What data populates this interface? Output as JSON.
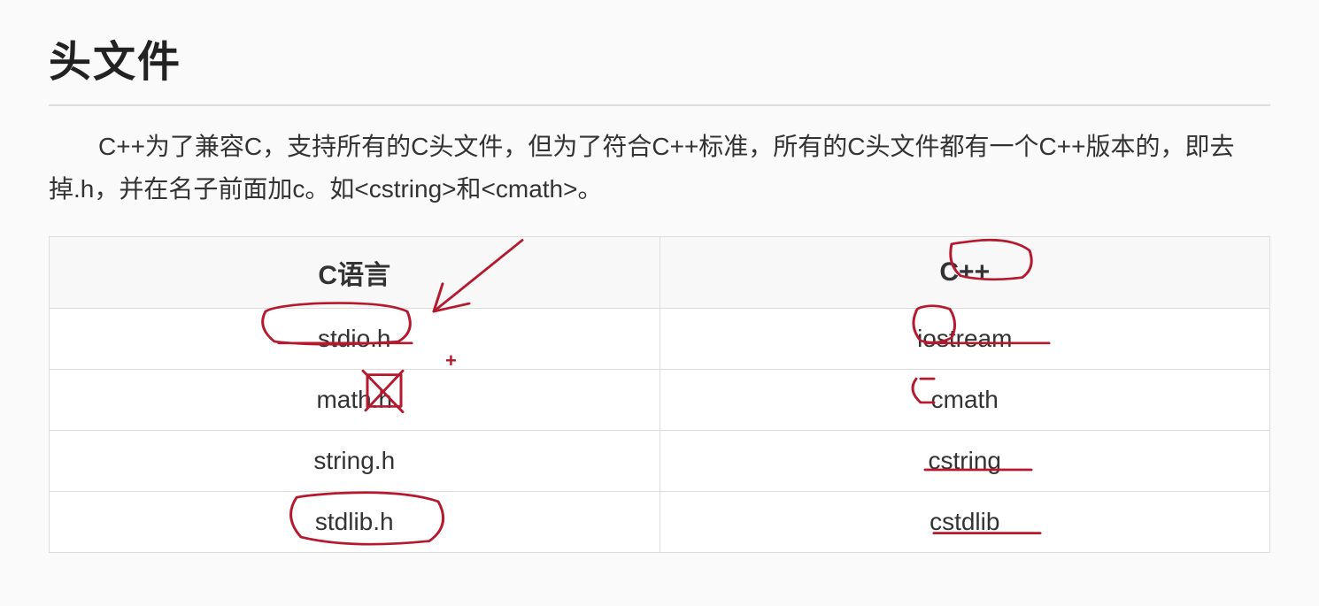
{
  "heading": "头文件",
  "description": "C++为了兼容C，支持所有的C头文件，但为了符合C++标准，所有的C头文件都有一个C++版本的，即去掉.h，并在名子前面加c。如<cstring>和<cmath>。",
  "table": {
    "headers": {
      "col1": "C语言",
      "col2": "C++"
    },
    "rows": [
      {
        "c": "stdio.h",
        "cpp": "iostream"
      },
      {
        "c": "math.h",
        "cpp": "cmath"
      },
      {
        "c": "string.h",
        "cpp": "cstring"
      },
      {
        "c": "stdlib.h",
        "cpp": "cstdlib"
      }
    ]
  },
  "annotation_color": "#b5192e",
  "cursor_symbol": "+"
}
